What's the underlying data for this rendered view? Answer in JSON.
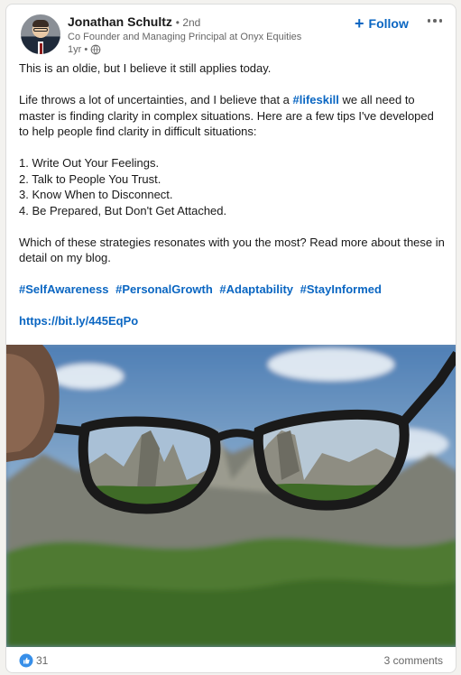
{
  "post": {
    "author": {
      "name": "Jonathan Schultz",
      "degree": "• 2nd",
      "headline": "Co Founder and Managing Principal at Onyx Equities",
      "time": "1yr •",
      "avatar_icon": "profile-photo",
      "visibility_icon": "globe-icon"
    },
    "follow_label": "Follow",
    "more_icon": "ellipsis-icon",
    "text": {
      "intro": "This is an oldie, but I believe it still applies today.",
      "para_before_tag": "Life throws a lot of uncertainties, and I believe that a ",
      "inline_tag": "#lifeskill",
      "para_after_tag": " we all need to master is finding clarity in complex situations. Here are a few tips I've developed to help people find clarity in difficult situations:",
      "tips": [
        "1. Write Out Your Feelings.",
        "2. Talk to People You Trust.",
        "3. Know When to Disconnect.",
        "4. Be Prepared, But Don't Get Attached."
      ],
      "question": "Which of these strategies resonates with you the most? Read more about these in detail on my blog.",
      "hashtags": [
        "#SelfAwareness",
        "#PersonalGrowth",
        "#Adaptability",
        "#StayInformed"
      ],
      "link": "https://bit.ly/445EqPo"
    },
    "image": {
      "subject": "hand holding eyeglasses bringing a rocky forested mountain into focus"
    },
    "stats": {
      "reaction_icon": "like-icon",
      "reaction_count": "31",
      "comments": "3 comments"
    }
  },
  "colors": {
    "accent": "#0a66c2",
    "text": "#191919",
    "muted": "#666666",
    "background": "#f3f2ef",
    "card": "#ffffff"
  }
}
